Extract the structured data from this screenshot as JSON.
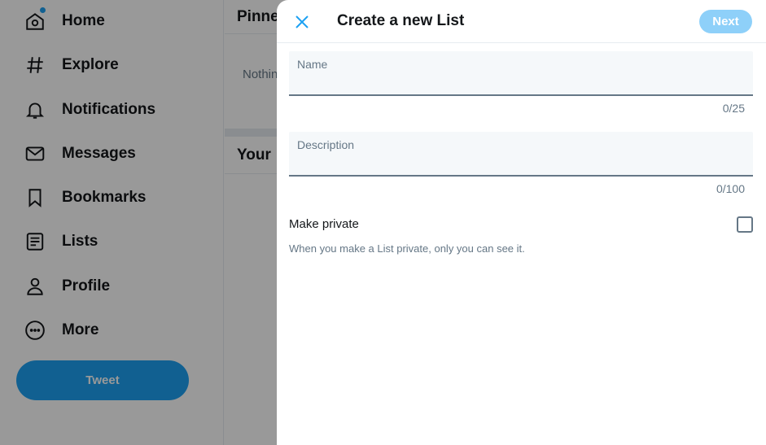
{
  "sidebar": {
    "items": [
      {
        "label": "Home",
        "icon": "home-icon"
      },
      {
        "label": "Explore",
        "icon": "hashtag-icon"
      },
      {
        "label": "Notifications",
        "icon": "bell-icon"
      },
      {
        "label": "Messages",
        "icon": "envelope-icon"
      },
      {
        "label": "Bookmarks",
        "icon": "bookmark-icon"
      },
      {
        "label": "Lists",
        "icon": "list-icon"
      },
      {
        "label": "Profile",
        "icon": "person-icon"
      },
      {
        "label": "More",
        "icon": "more-circle-icon"
      }
    ],
    "tweet_label": "Tweet"
  },
  "main": {
    "pinned_title": "Pinne",
    "pinned_empty": "Nothin",
    "your_lists_title": "Your"
  },
  "modal": {
    "title": "Create a new List",
    "next_label": "Next",
    "name_label": "Name",
    "name_value": "",
    "name_counter": "0/25",
    "description_label": "Description",
    "description_value": "",
    "description_counter": "0/100",
    "private_label": "Make private",
    "private_help": "When you make a List private, only you can see it."
  },
  "colors": {
    "accent": "#1da1f2",
    "accent_disabled": "#8ed0f9",
    "text_primary": "#14171a",
    "text_secondary": "#657786"
  }
}
